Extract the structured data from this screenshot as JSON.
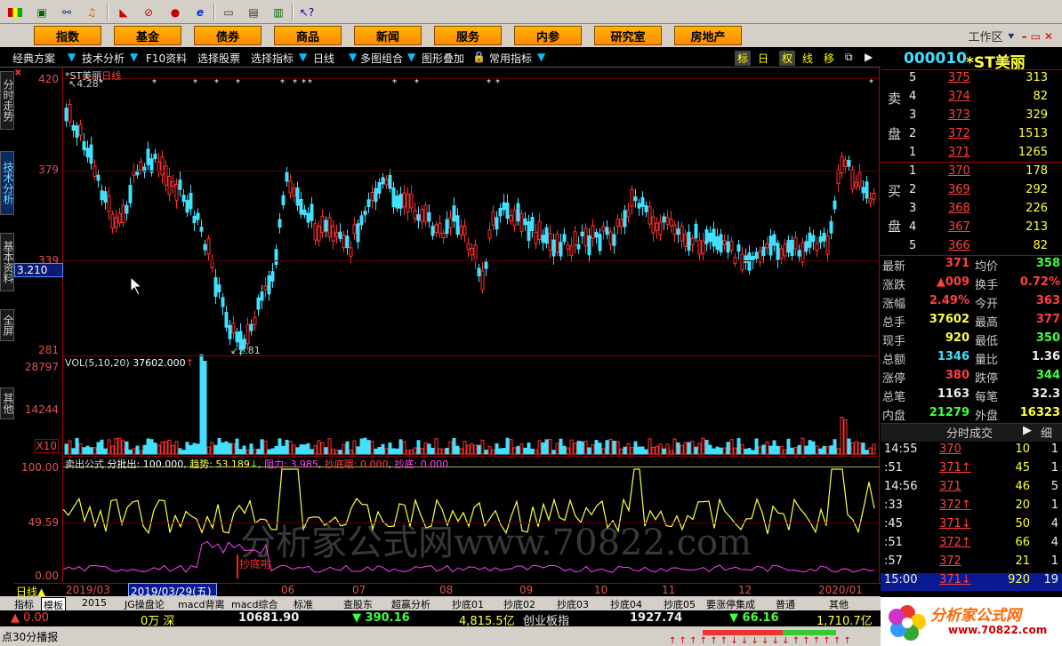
{
  "toolbar": {
    "icons": [
      "flag-icon",
      "network-icon",
      "binoculars-icon",
      "bell-icon",
      "chart-icon",
      "stop-icon",
      "blog-icon",
      "ie-icon",
      "window-icon",
      "list-icon",
      "book-icon",
      "help-icon"
    ]
  },
  "menu": {
    "items": [
      "指数",
      "基金",
      "债券",
      "商品",
      "新闻",
      "服务",
      "内参",
      "研究室",
      "房地产"
    ],
    "workarea": "工作区"
  },
  "subbar": {
    "items": [
      "经典方案",
      "技术分析",
      "F10资料",
      "选择股票",
      "选择指标",
      "日线",
      "多图组合",
      "图形叠加",
      "常用指标"
    ],
    "right": [
      "标",
      "日",
      "权",
      "线",
      "移"
    ]
  },
  "lefttabs": [
    "分时走势",
    "技术分析",
    "基本资料",
    "全屏",
    "其他"
  ],
  "price_axis": {
    "labels": [
      "420",
      "379",
      "339",
      "281"
    ],
    "cursor": "3.210"
  },
  "vol_axis": {
    "labels": [
      "28797",
      "14244"
    ],
    "unit": "X10"
  },
  "ind_axis": {
    "labels": [
      "100.00",
      "49.59",
      "0.00"
    ]
  },
  "main_chart": {
    "title": "*ST美丽",
    "period": "日线",
    "high_label": "4.28",
    "low_label": "2.81"
  },
  "vol_chart": {
    "title": "VOL(5,10,20)",
    "value": "37602.000",
    "arrow": "↑"
  },
  "ind_chart": {
    "title": "卖出公式",
    "line1": "分批出: 100.000",
    "line2": "趋势: 53.189",
    "arrow": "↓",
    "line3": "阻力: 3.985",
    "line4": "抄底哦: 0.000",
    "line5": "抄底: 0.000",
    "signal": "抄底啦"
  },
  "datebar": {
    "period": "日线",
    "labels": [
      "2019/03",
      "06",
      "07",
      "08",
      "09",
      "10",
      "11",
      "12",
      "2020/01"
    ],
    "cursor": "2019/03/29(五)"
  },
  "tabs": [
    "指标",
    "模板",
    "2015",
    "JG操盘论",
    "macd背离",
    "macd综合",
    "标准",
    "查股东",
    "超赢分析",
    "抄底01",
    "抄底02",
    "抄底03",
    "抄底04",
    "抄底05",
    "要涨停集成",
    "普通",
    "其他"
  ],
  "status": {
    "s1": "▲ 0.00",
    "s2": "0万 深",
    "s3": "10681.90",
    "s4": "▼ 390.16",
    "s5": "4,815.5亿",
    "s6": "创业板指",
    "s7": "1927.74",
    "s8": "▼ 66.16",
    "s9": "1,710.7亿"
  },
  "bottom": {
    "left": "点30分播报"
  },
  "quote": {
    "code": "000010",
    "name": "*ST美丽",
    "sell": [
      [
        "5",
        "375",
        "313"
      ],
      [
        "4",
        "374",
        "82"
      ],
      [
        "3",
        "373",
        "329"
      ],
      [
        "2",
        "372",
        "1513"
      ],
      [
        "1",
        "371",
        "1265"
      ]
    ],
    "buy": [
      [
        "1",
        "370",
        "178"
      ],
      [
        "2",
        "369",
        "292"
      ],
      [
        "3",
        "368",
        "226"
      ],
      [
        "4",
        "367",
        "213"
      ],
      [
        "5",
        "366",
        "82"
      ]
    ],
    "sell_label": [
      "卖",
      "盘"
    ],
    "buy_label": [
      "买",
      "盘"
    ],
    "stats": [
      [
        "最新",
        "371",
        "均价",
        "358"
      ],
      [
        "涨跌",
        "▲009",
        "换手",
        "0.72%"
      ],
      [
        "涨幅",
        "2.49%",
        "今开",
        "363"
      ],
      [
        "总手",
        "37602",
        "最高",
        "377"
      ],
      [
        "现手",
        "920",
        "最低",
        "350"
      ],
      [
        "总额",
        "1346",
        "量比",
        "1.36"
      ],
      [
        "涨停",
        "380",
        "跌停",
        "344"
      ],
      [
        "总笔",
        "1163",
        "每笔",
        "32.3"
      ],
      [
        "内盘",
        "21279",
        "外盘",
        "16323"
      ]
    ],
    "ticks_title": "分时成交",
    "ticks_btn": "细",
    "ticks": [
      [
        "14:55",
        "370",
        "10",
        "1"
      ],
      [
        ":51",
        "371↑",
        "45",
        "1"
      ],
      [
        "14:56",
        "371",
        "46",
        "5"
      ],
      [
        ":33",
        "372↑",
        "20",
        "1"
      ],
      [
        ":45",
        "371↓",
        "50",
        "4"
      ],
      [
        ":51",
        "372↑",
        "66",
        "4"
      ],
      [
        ":57",
        "372",
        "21",
        "1"
      ],
      [
        "15:00",
        "371↓",
        "920",
        "19"
      ]
    ]
  },
  "watermark": "分析家公式网www.70822.com",
  "logo": {
    "text": "分析家公式网",
    "url": "www.70822.com"
  }
}
